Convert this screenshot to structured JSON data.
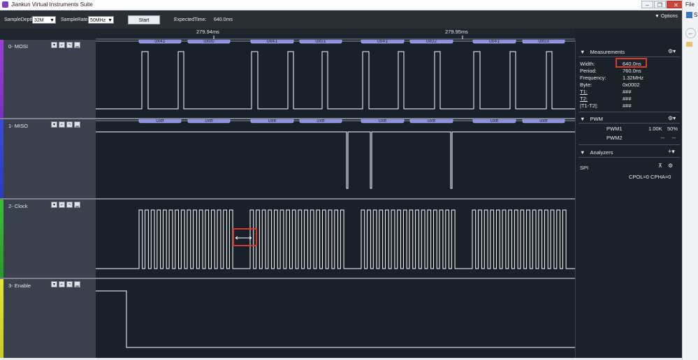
{
  "window": {
    "title": "Jiankun Virtual Instruments Suite"
  },
  "toolbar": {
    "sample_depth_label": "SampleDepth",
    "sample_depth_value": "32M",
    "sample_rate_label": "SampleRate",
    "sample_rate_value": "50MHz",
    "start_label": "Start",
    "expected_time_label": "ExpectedTime:",
    "expected_time_value": "640.0ms",
    "options_label": "Options"
  },
  "ruler": {
    "tick1": "279.94ms",
    "tick2": "279.95ms"
  },
  "channels": [
    {
      "name": "0- MOSI",
      "color": "#9b3fd8",
      "decodes": [
        "0x41",
        "0x00",
        "0x41",
        "0x01",
        "0x41",
        "0x02",
        "0x41",
        "0x03"
      ]
    },
    {
      "name": "1- MISO",
      "color": "#3a4bd8",
      "decodes": [
        "0xff",
        "0xff",
        "0xff",
        "0xff",
        "0xff",
        "0xff",
        "0xff",
        "0xff"
      ]
    },
    {
      "name": "2- Clock",
      "color": "#3bbf3b",
      "decodes": []
    },
    {
      "name": "3- Enable",
      "color": "#d6d62a",
      "decodes": []
    }
  ],
  "measurements": {
    "title": "Measurements",
    "width_label": "Width:",
    "width_value": "640.0ns",
    "period_label": "Period:",
    "period_value": "760.0ns",
    "frequency_label": "Frequency:",
    "frequency_value": "1.32MHz",
    "byte_label": "Byte:",
    "byte_value": "0x0002",
    "t1_label": "T1:",
    "t1_value": "###",
    "t2_label": "T2:",
    "t2_value": "###",
    "t1t2_label": "|T1-T2|:",
    "t1t2_value": "###"
  },
  "pwm": {
    "title": "PWM",
    "pwm1_label": "PWM1",
    "pwm1_freq": "1.00K",
    "pwm1_duty": "50%",
    "pwm2_label": "PWM2",
    "pwm2_freq": "--",
    "pwm2_duty": "--"
  },
  "analyzers": {
    "title": "Analyzers",
    "spi_label": "SPI",
    "spi_info": "CPOL=0 CPHA=0"
  },
  "right_strip": {
    "file": "File",
    "s": "S"
  }
}
